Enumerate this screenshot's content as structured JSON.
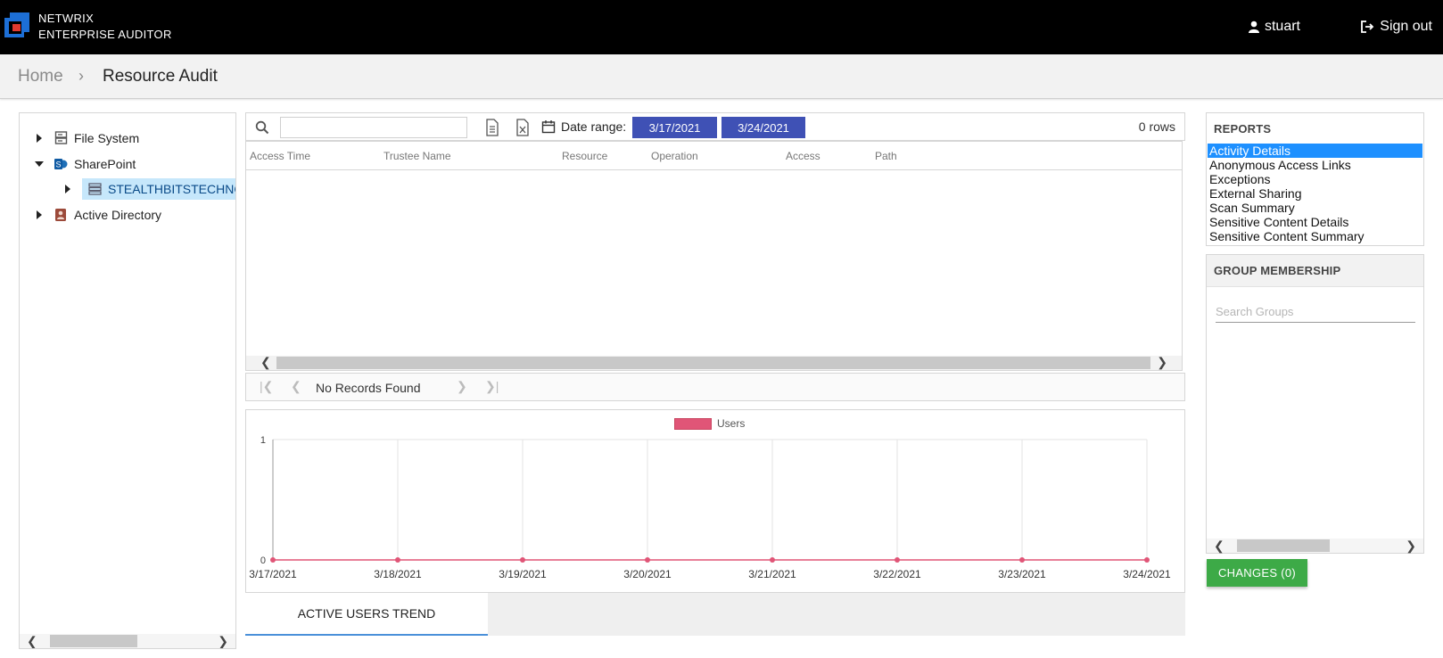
{
  "app": {
    "brand_line1": "NETWRIX",
    "brand_line2": "ENTERPRISE AUDITOR",
    "user_name": "stuart",
    "signout_label": "Sign out"
  },
  "breadcrumb": {
    "home": "Home",
    "separator": "›",
    "current": "Resource Audit"
  },
  "tree": {
    "items": [
      {
        "label": "File System",
        "expanded": false,
        "icon": "file-server-icon"
      },
      {
        "label": "SharePoint",
        "expanded": true,
        "icon": "sharepoint-icon"
      },
      {
        "label": "STEALTHBITSTECHNO",
        "expanded": false,
        "icon": "server-icon",
        "selected": true
      },
      {
        "label": "Active Directory",
        "expanded": false,
        "icon": "directory-icon"
      }
    ]
  },
  "toolbar": {
    "search_value": "",
    "date_range_label": "Date range:",
    "start_date": "3/17/2021",
    "end_date": "3/24/2021",
    "row_count": "0 rows"
  },
  "grid": {
    "columns": [
      "Access Time",
      "Trustee Name",
      "Resource",
      "Operation",
      "Access",
      "Path"
    ],
    "rows": []
  },
  "pager": {
    "status": "No Records Found"
  },
  "chart_data": {
    "type": "line",
    "x": [
      "3/17/2021",
      "3/18/2021",
      "3/19/2021",
      "3/20/2021",
      "3/21/2021",
      "3/22/2021",
      "3/23/2021",
      "3/24/2021"
    ],
    "series": [
      {
        "name": "Users",
        "values": [
          0,
          0,
          0,
          0,
          0,
          0,
          0,
          0
        ],
        "color": "#e05577"
      }
    ],
    "y_ticks": [
      "0",
      "1"
    ],
    "ylim": [
      0,
      1
    ],
    "grid": true,
    "legend": "top-center"
  },
  "tabs": {
    "active": "ACTIVE USERS TREND"
  },
  "reports": {
    "title": "REPORTS",
    "items": [
      "Activity Details",
      "Anonymous Access Links",
      "Exceptions",
      "External Sharing",
      "Scan Summary",
      "Sensitive Content Details",
      "Sensitive Content Summary"
    ],
    "selected_index": 0
  },
  "groups": {
    "title": "GROUP MEMBERSHIP",
    "search_placeholder": "Search Groups"
  },
  "changes": {
    "label": "CHANGES (0)"
  },
  "colors": {
    "accent": "#3f51b5",
    "selection": "#1e90ff",
    "success": "#3daa47",
    "series": "#e05577"
  }
}
